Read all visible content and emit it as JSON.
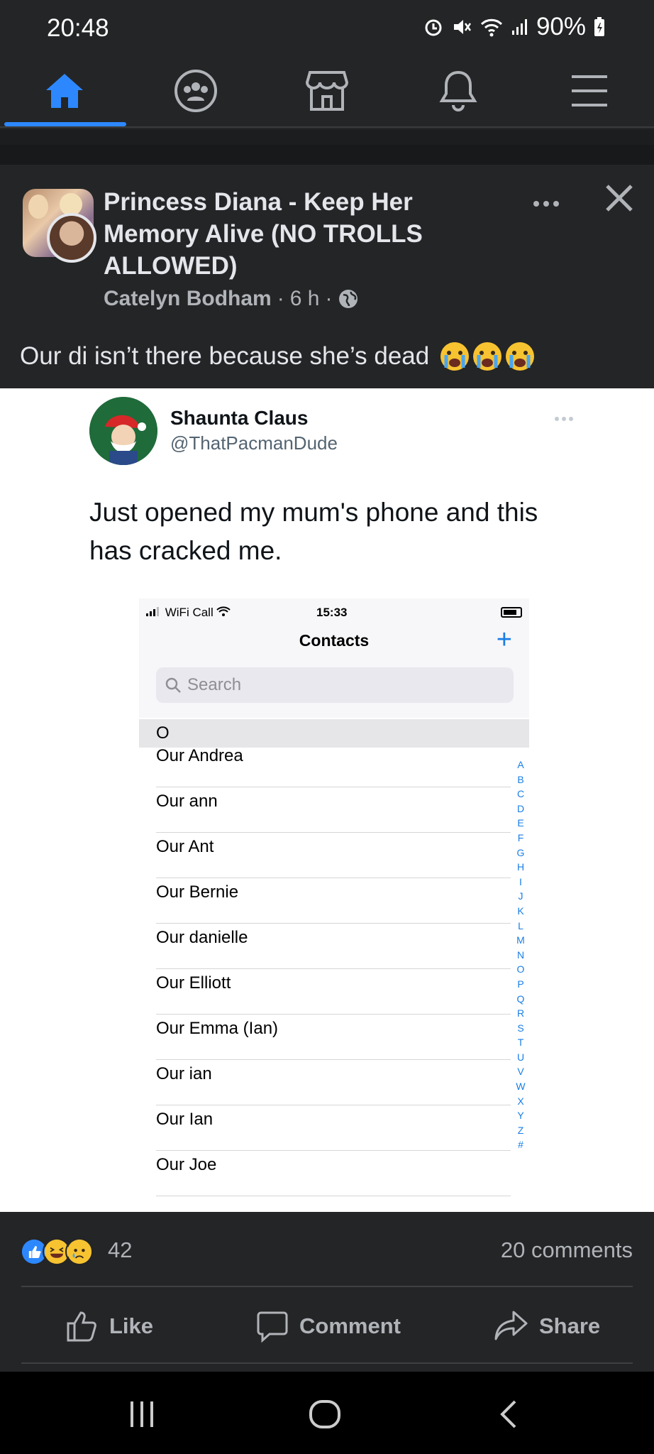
{
  "status_bar": {
    "time": "20:48",
    "battery": "90%"
  },
  "nav": {
    "tabs": [
      "home-icon",
      "groups-icon",
      "marketplace-icon",
      "bell-icon",
      "menu-icon"
    ],
    "active": "home"
  },
  "post": {
    "group_name": "Princess Diana - Keep Her Memory Alive (NO TROLLS ALLOWED)",
    "author": "Catelyn Bodham",
    "time": "6 h",
    "dot": "·",
    "privacy_icon": "globe-icon",
    "text": "Our di isn’t there because she’s dead"
  },
  "tweet": {
    "name": "Shaunta Claus",
    "handle": "@ThatPacmanDude",
    "text": "Just opened my mum's phone and this has cracked me."
  },
  "phone": {
    "carrier": "WiFi Call",
    "time": "15:33",
    "title": "Contacts",
    "plus": "+",
    "search_placeholder": "Search",
    "section": "O",
    "contacts": [
      "Our Andrea",
      "Our ann",
      "Our Ant",
      "Our Bernie",
      "Our danielle",
      "Our Elliott",
      "Our Emma (Ian)",
      "Our ian",
      "Our Ian",
      "Our Joe"
    ],
    "index": [
      "A",
      "B",
      "C",
      "D",
      "E",
      "F",
      "G",
      "H",
      "I",
      "J",
      "K",
      "L",
      "M",
      "N",
      "O",
      "P",
      "Q",
      "R",
      "S",
      "T",
      "U",
      "V",
      "W",
      "X",
      "Y",
      "Z",
      "#"
    ]
  },
  "reactions": {
    "count": "42",
    "comments": "20 comments",
    "types": [
      "like",
      "haha",
      "sad"
    ]
  },
  "actions": {
    "like": "Like",
    "comment": "Comment",
    "share": "Share"
  },
  "colors": {
    "background": "#242526",
    "accent": "#2d88ff",
    "text": "#e4e6eb",
    "muted": "#b0b3b8"
  }
}
